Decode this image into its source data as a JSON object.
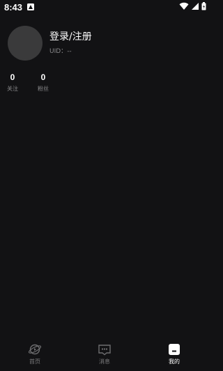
{
  "status_bar": {
    "time": "8:43"
  },
  "profile": {
    "login_label": "登录/注册",
    "uid_prefix": "UID：",
    "uid_value": "--"
  },
  "stats": [
    {
      "value": "0",
      "label": "关注"
    },
    {
      "value": "0",
      "label": "粉丝"
    }
  ],
  "bottom_nav": {
    "items": [
      {
        "label": "首页",
        "icon": "home-planet-icon",
        "active": false
      },
      {
        "label": "消息",
        "icon": "message-box-icon",
        "active": false
      },
      {
        "label": "我的",
        "icon": "profile-icon",
        "active": true
      }
    ]
  },
  "colors": {
    "background": "#121214",
    "avatar": "#3a3a3b",
    "text_primary": "#ffffff",
    "text_secondary": "#8a8a8c",
    "nav_inactive": "#7c7c7e"
  }
}
